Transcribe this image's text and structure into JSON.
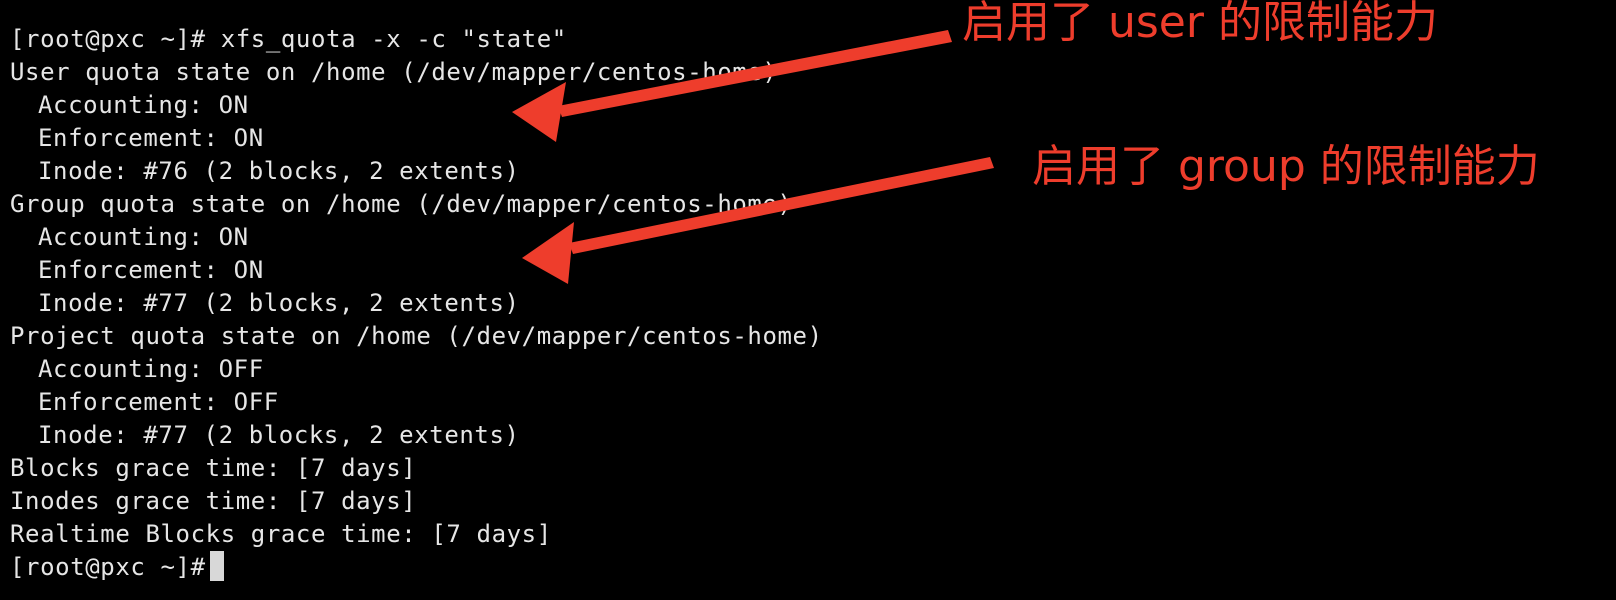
{
  "terminal": {
    "lines": [
      "[root@pxc ~]# xfs_quota -x -c \"state\"",
      "User quota state on /home (/dev/mapper/centos-home)",
      "Accounting: ON",
      "Enforcement: ON",
      "Inode: #76 (2 blocks, 2 extents)",
      "Group quota state on /home (/dev/mapper/centos-home)",
      "Accounting: ON",
      "Enforcement: ON",
      "Inode: #77 (2 blocks, 2 extents)",
      "Project quota state on /home (/dev/mapper/centos-home)",
      "Accounting: OFF",
      "Enforcement: OFF",
      "Inode: #77 (2 blocks, 2 extents)",
      "Blocks grace time: [7 days]",
      "Inodes grace time: [7 days]",
      "Realtime Blocks grace time: [7 days]",
      "[root@pxc ~]#"
    ]
  },
  "annotations": {
    "user": "启用了 user 的限制能力",
    "group": "启用了 group 的限制能力"
  },
  "colors": {
    "background": "#000000",
    "text": "#e6e6e6",
    "annotation": "#ee3d2c"
  }
}
